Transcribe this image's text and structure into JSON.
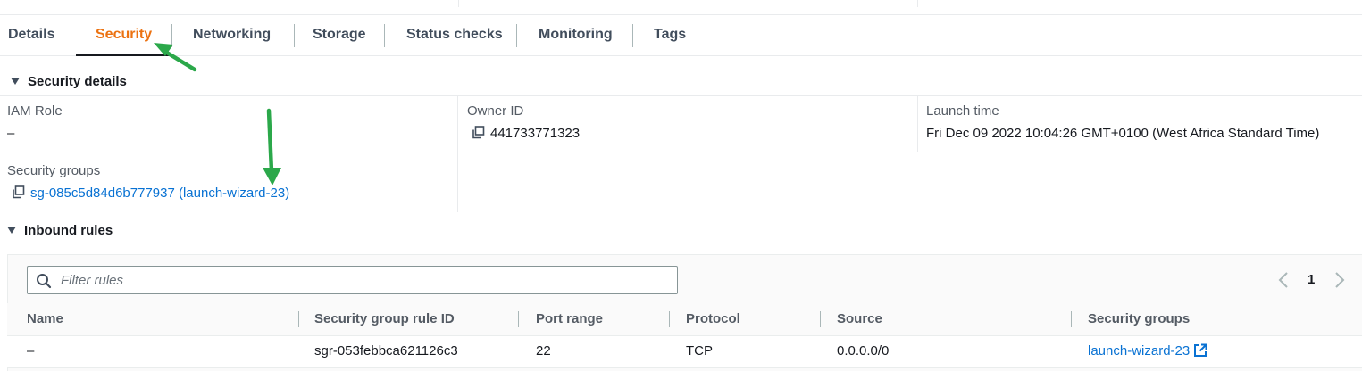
{
  "tabs": [
    {
      "label": "Details",
      "active": false
    },
    {
      "label": "Security",
      "active": true
    },
    {
      "label": "Networking",
      "active": false
    },
    {
      "label": "Storage",
      "active": false
    },
    {
      "label": "Status checks",
      "active": false
    },
    {
      "label": "Monitoring",
      "active": false
    },
    {
      "label": "Tags",
      "active": false
    }
  ],
  "security_details": {
    "title": "Security details",
    "iam_role": {
      "label": "IAM Role",
      "value": "–"
    },
    "owner_id": {
      "label": "Owner ID",
      "value": "441733771323"
    },
    "launch_time": {
      "label": "Launch time",
      "value": "Fri Dec 09 2022 10:04:26 GMT+0100 (West Africa Standard Time)"
    },
    "security_groups": {
      "label": "Security groups",
      "value": "sg-085c5d84d6b777937 (launch-wizard-23)"
    }
  },
  "inbound_rules": {
    "title": "Inbound rules",
    "filter_placeholder": "Filter rules",
    "page": "1",
    "columns": [
      "Name",
      "Security group rule ID",
      "Port range",
      "Protocol",
      "Source",
      "Security groups"
    ],
    "rows": [
      {
        "name": "–",
        "rule_id": "sgr-053febbca621126c3",
        "port_range": "22",
        "protocol": "TCP",
        "source": "0.0.0.0/0",
        "security_group": "launch-wizard-23"
      }
    ]
  },
  "colors": {
    "accent": "#ec7211",
    "link": "#0972d3",
    "annotation_arrow": "#2ba84a"
  },
  "icons": [
    "copy-icon",
    "search-icon",
    "chevron-left-icon",
    "chevron-right-icon",
    "external-link-icon",
    "caret-down-icon",
    "annotation-arrow-icon"
  ]
}
